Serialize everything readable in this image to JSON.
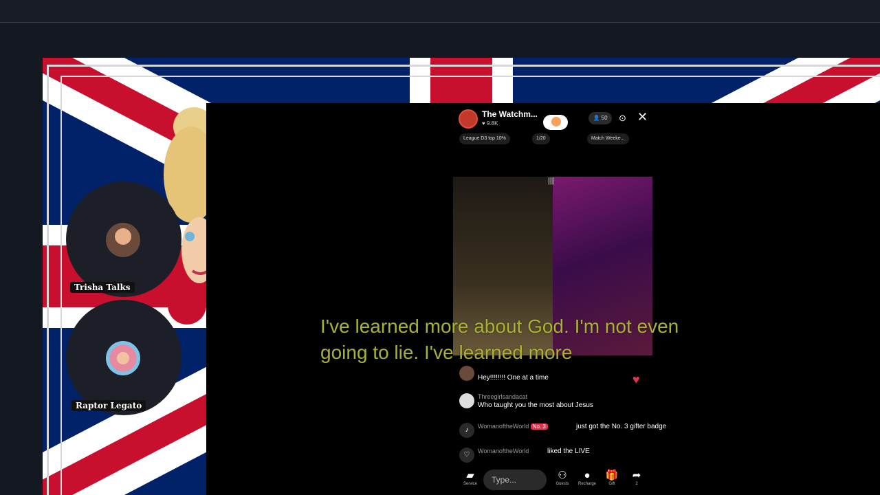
{
  "stream": {
    "host_name": "The Watchm...",
    "host_likes": "9.8K",
    "viewer_count": "50",
    "chips": [
      "League D3 top 10%",
      "1/20",
      "Match Weeke..."
    ]
  },
  "participants": [
    {
      "name": "Trisha Talks"
    },
    {
      "name": "Raptor Legato"
    }
  ],
  "caption": "I've learned more about God. I'm not even going to lie. I've learned more",
  "comments": [
    {
      "user": "",
      "text": "Hey!!!!!!!! One at a time"
    },
    {
      "user": "Threegirlsandacat",
      "text": "Who taught you the most about Jesus"
    },
    {
      "user": "WomanoftheWorld",
      "badge": "No. 3",
      "text": "just got the No. 3 gifter badge"
    },
    {
      "user": "WomanoftheWorld",
      "text": "liked the LIVE"
    }
  ],
  "bottom_bar": {
    "placeholder": "Type...",
    "items": [
      "Service",
      "Guests",
      "Recharge",
      "Gift",
      "2"
    ]
  },
  "icons": [
    "close-icon",
    "heart-icon",
    "share-icon",
    "gift-icon",
    "guests-icon"
  ],
  "colors": {
    "caption": "#aab233",
    "heart": "#e2334c",
    "flag_red": "#c8102e",
    "flag_blue": "#012169"
  }
}
